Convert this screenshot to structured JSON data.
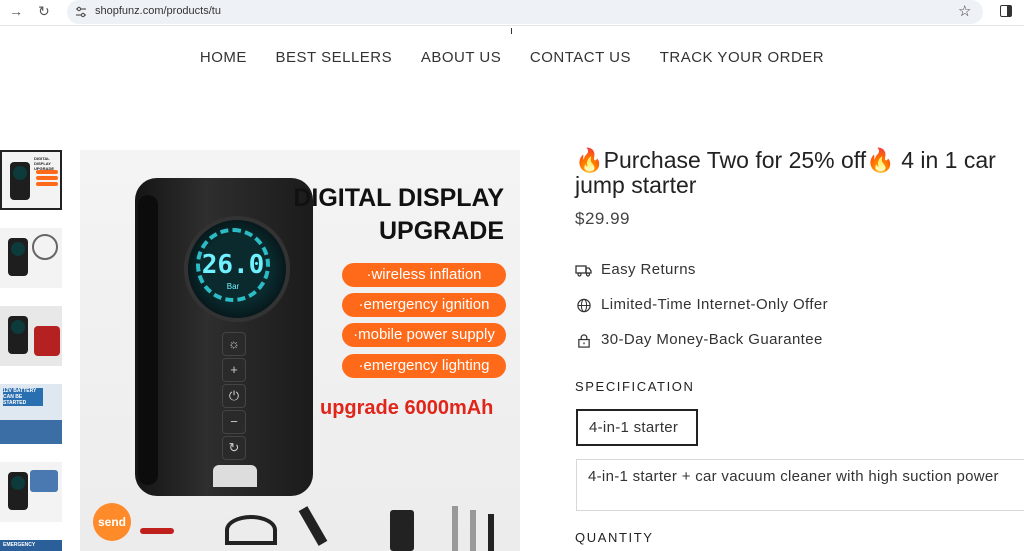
{
  "browser": {
    "url": "shopfunz.com/products/tu"
  },
  "nav": {
    "items": [
      "HOME",
      "BEST SELLERS",
      "ABOUT US",
      "CONTACT US",
      "TRACK YOUR ORDER"
    ]
  },
  "gallery": {
    "thumb_labels": [
      "DIGITAL DISPLAY UPGRADE",
      "12V BATTERY CAN BE STARTED",
      "EMERGENCY"
    ],
    "main_image": {
      "headline_line1": "DIGITAL DISPLAY",
      "headline_line2": "UPGRADE",
      "features": [
        "·wireless inflation",
        "·emergency ignition",
        "·mobile power supply",
        "·emergency lighting"
      ],
      "upgrade": "upgrade 6000mAh",
      "screen_readout": "26.0",
      "screen_unit": "Bar",
      "badge": "send"
    }
  },
  "product": {
    "title": "🔥Purchase Two for 25% off🔥 4 in 1 car jump starter",
    "price": "$29.99",
    "features": [
      {
        "icon": "truck-icon",
        "label": "Easy Returns"
      },
      {
        "icon": "globe-icon",
        "label": "Limited-Time Internet-Only Offer"
      },
      {
        "icon": "lock-icon",
        "label": "30-Day Money-Back Guarantee"
      }
    ],
    "specification_label": "SPECIFICATION",
    "variants": [
      "4-in-1 starter",
      "4-in-1 starter + car vacuum cleaner with high suction power"
    ],
    "quantity_label": "QUANTITY"
  },
  "colors": {
    "accent_orange": "#ff6a1a",
    "promo_red": "#e0261b",
    "screen_cyan": "#6ff1ff"
  }
}
